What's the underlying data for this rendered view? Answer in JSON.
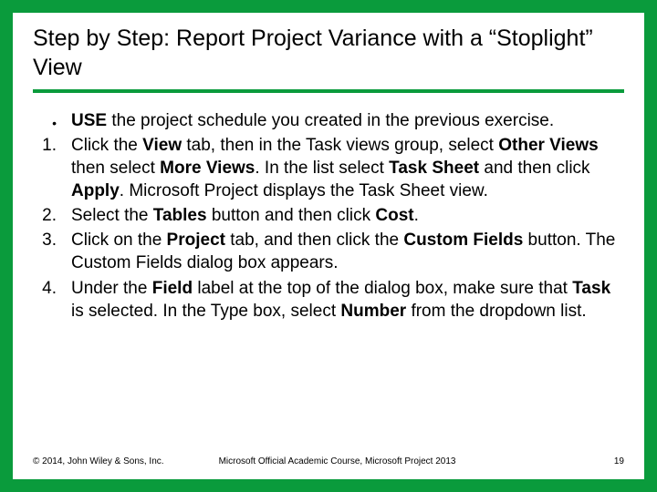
{
  "title": "Step by Step: Report Project Variance with a “Stoplight” View",
  "items": [
    {
      "marker": "•",
      "html": "<b>USE</b> the project schedule you created in the previous exercise."
    },
    {
      "marker": "1.",
      "html": "Click the <b>View</b> tab, then in the Task views group, select <b>Other Views</b> then select <b>More Views</b>. In the list select <b>Task Sheet</b> and then click <b>Apply</b>. Microsoft Project displays the Task Sheet view."
    },
    {
      "marker": "2.",
      "html": "Select the <b>Tables</b> button and then click <b>Cost</b>."
    },
    {
      "marker": "3.",
      "html": "Click on the <b>Project</b> tab, and then click the <b>Custom Fields</b> button. The Custom Fields dialog box appears."
    },
    {
      "marker": "4.",
      "html": "Under the <b>Field</b> label at the top of the dialog box, make sure that <b>Task</b> is selected. In the Type box, select <b>Number</b> from the dropdown list."
    }
  ],
  "footer": {
    "copyright": "© 2014, John Wiley & Sons, Inc.",
    "course": "Microsoft Official Academic Course, Microsoft Project 2013",
    "page": "19"
  }
}
